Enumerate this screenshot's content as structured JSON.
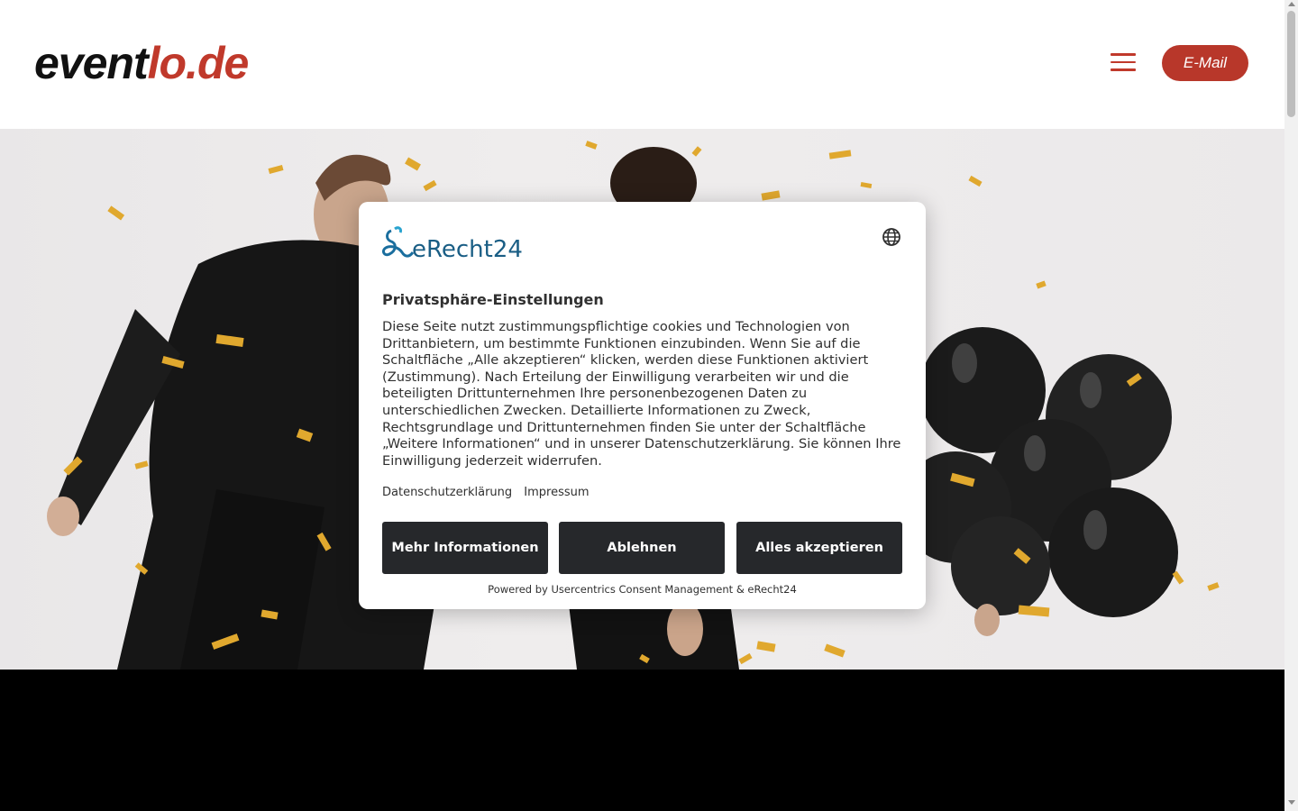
{
  "header": {
    "logo_part1": "event",
    "logo_part2": "lo.de",
    "email_label": "E-Mail",
    "brand_color": "#c0392b"
  },
  "consent": {
    "provider_logo_text": "eRecht24",
    "title": "Privatsphäre-Einstellungen",
    "body": "Diese Seite nutzt zustimmungspflichtige cookies und Technologien von Drittanbietern, um bestimmte Funktionen einzubinden. Wenn Sie auf die Schaltfläche „Alle akzeptieren“ klicken, werden diese Funktionen aktiviert (Zustimmung). Nach Erteilung der Einwilligung verarbeiten wir und die beteiligten Drittunternehmen Ihre personenbezogenen Daten zu unterschiedlichen Zwecken. Detaillierte Informationen zu Zweck, Rechtsgrundlage und Drittunternehmen finden Sie unter der Schaltfläche „Weitere Informationen“ und in unserer Datenschutzerklärung. Sie können Ihre Einwilligung jederzeit widerrufen.",
    "link_privacy": "Datenschutzerklärung",
    "link_imprint": "Impressum",
    "btn_more": "Mehr Informationen",
    "btn_deny": "Ablehnen",
    "btn_accept": "Alles akzeptieren",
    "powered_by": "Powered by Usercentrics Consent Management & eRecht24",
    "button_color": "#26282b"
  },
  "icons": {
    "menu": "hamburger-icon",
    "language": "globe-icon"
  }
}
